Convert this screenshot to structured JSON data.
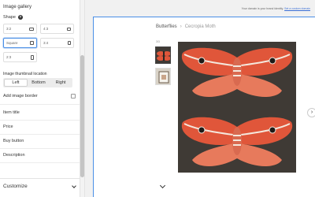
{
  "panel": {
    "title": "Image gallery",
    "shape_label": "Shape",
    "shape_options": [
      {
        "label": "3:2",
        "selected": false
      },
      {
        "label": "4:3",
        "selected": false
      },
      {
        "label": "Square",
        "selected": true
      },
      {
        "label": "3:4",
        "selected": false
      },
      {
        "label": "2:3",
        "selected": false
      }
    ],
    "location_label": "Image thumbnail location",
    "location_options": [
      "Left",
      "Bottom",
      "Right"
    ],
    "location_selected": "Left",
    "border_label": "Add image border",
    "rows": [
      "Item title",
      "Price",
      "Buy button",
      "Description"
    ],
    "customize_label": "Customize"
  },
  "preview": {
    "notice_text": "Your domain is your brand identity.",
    "notice_link": "Set a custom domain",
    "breadcrumb": {
      "parent": "Butterflies",
      "separator": "›",
      "current": "Cecropia Moth"
    },
    "thumb_count_label": "3/3"
  },
  "colors": {
    "accent": "#4a8fe6",
    "moth_wing": "#e0563a",
    "image_bg": "#3f3a35"
  }
}
